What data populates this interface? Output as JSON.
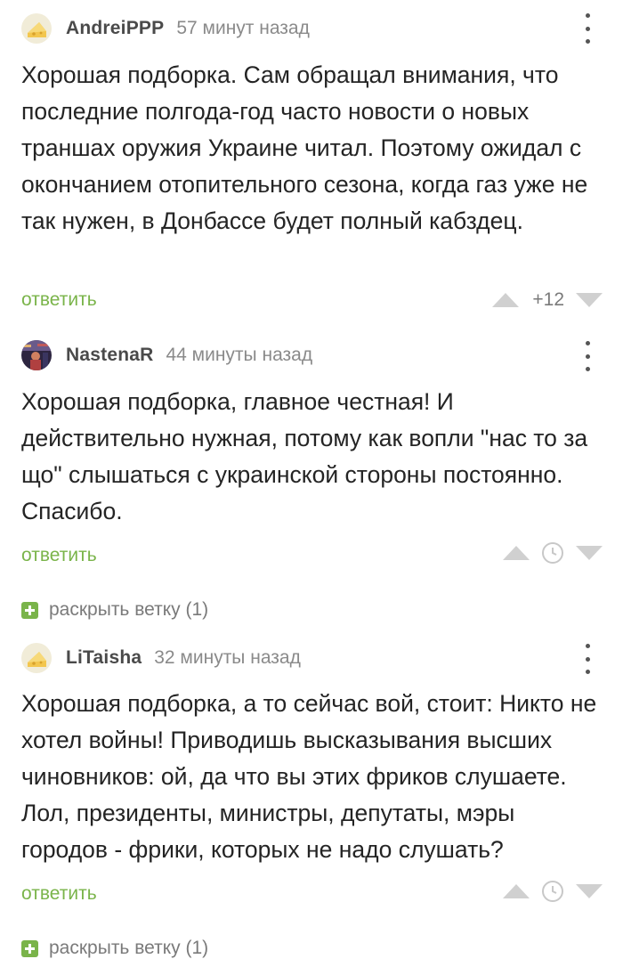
{
  "comments": [
    {
      "username": "AndreiPPP",
      "time": "57 минут назад",
      "avatar_icon": "cheese-placeholder-avatar",
      "text": "Хорошая подборка. Сам обращал внимания, что последние полгода-год часто новости о новых траншах оружия Украине читал. Поэтому ожидал с окончанием отопительного сезона, когда газ уже не так нужен, в Донбассе будет полный кабздец.",
      "reply_label": "ответить",
      "rating": "+12"
    },
    {
      "username": "NastenaR",
      "time": "44 минуты назад",
      "avatar_icon": "photo-avatar",
      "text": "Хорошая подборка, главное честная! И действительно нужная, потому как вопли \"нас то за що\" слышаться с украинской стороны постоянно. Спасибо.",
      "reply_label": "ответить",
      "expand_label": "раскрыть ветку (1)"
    },
    {
      "username": "LiTaisha",
      "time": "32 минуты назад",
      "avatar_icon": "cheese-placeholder-avatar",
      "text": "Хорошая подборка, а то сейчас вой, стоит: Никто не хотел войны! Приводишь высказывания высших чиновников: ой, да что вы этих фриков слушаете. Лол, президенты, министры, депутаты, мэры городов - фрики, которых не надо слушать?",
      "reply_label": "ответить",
      "expand_label": "раскрыть ветку (1)"
    }
  ],
  "colors": {
    "accent_green": "#7ab44a",
    "vote_arrow": "#d0d0d0",
    "meta_gray": "#8a8a8a"
  }
}
